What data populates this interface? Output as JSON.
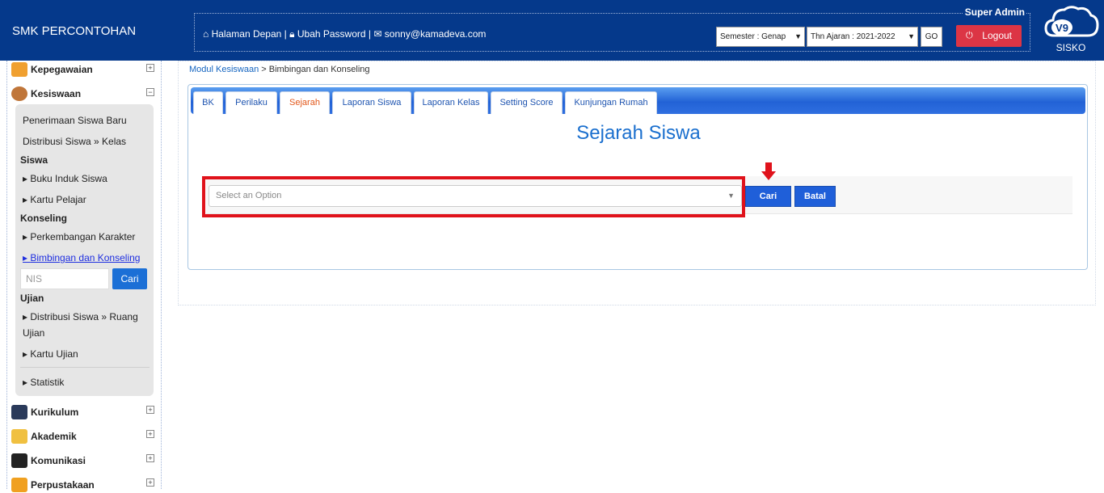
{
  "header": {
    "brand": "SMK PERCONTOHAN",
    "role": "Super Admin",
    "links": {
      "home": "Halaman Depan",
      "password": "Ubah Password",
      "email": "sonny@kamadeva.com",
      "sep": "|"
    },
    "semester_select": "Semester : Genap",
    "year_select": "Thn Ajaran : 2021-2022",
    "go_label": "GO",
    "logout_label": "Logout",
    "logo_badge": "V9",
    "logo_text": "SISKO"
  },
  "sidebar": {
    "menus": [
      {
        "label": "Kepegawaian",
        "icon": "people-icon"
      },
      {
        "label": "Kesiswaan",
        "icon": "student-icon"
      },
      {
        "label": "Kurikulum",
        "icon": "graduation-cap-icon"
      },
      {
        "label": "Akademik",
        "icon": "pencil-icon"
      },
      {
        "label": "Komunikasi",
        "icon": "contact-icon"
      },
      {
        "label": "Perpustakaan",
        "icon": "book-icon"
      }
    ],
    "sub": {
      "penerimaan": "Penerimaan Siswa Baru",
      "distribusi_kelas": "Distribusi Siswa » Kelas",
      "hdr_siswa": "Siswa",
      "buku_induk": "Buku Induk Siswa",
      "kartu_pelajar": "Kartu Pelajar",
      "hdr_konseling": "Konseling",
      "perkembangan": "Perkembangan Karakter",
      "bimbingan": "Bimbingan dan Konseling",
      "nis_placeholder": "NIS",
      "cari": "Cari",
      "hdr_ujian": "Ujian",
      "distribusi_ruang_1": "Distribusi Siswa » Ruang",
      "distribusi_ruang_2": "Ujian",
      "kartu_ujian": "Kartu Ujian",
      "statistik": "Statistik"
    }
  },
  "breadcrumb": {
    "link": "Modul Kesiswaan",
    "sep": ">",
    "current": "Bimbingan dan Konseling"
  },
  "tabs": [
    "BK",
    "Perilaku",
    "Sejarah",
    "Laporan Siswa",
    "Laporan Kelas",
    "Setting Score",
    "Kunjungan Rumah"
  ],
  "active_tab": "Sejarah",
  "main": {
    "title": "Sejarah Siswa",
    "select_placeholder": "Select an Option",
    "cari": "Cari",
    "batal": "Batal"
  },
  "colors": {
    "header_bg": "#05398b",
    "accent": "#1f5fd9",
    "highlight": "#e0121b",
    "logout": "#dc3545"
  }
}
